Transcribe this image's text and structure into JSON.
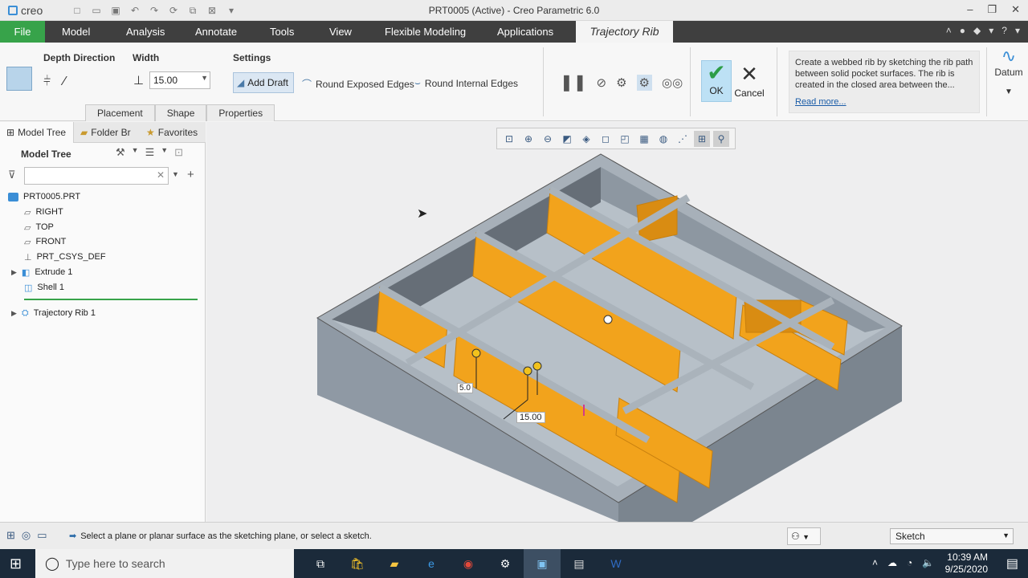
{
  "window": {
    "brand": "creo",
    "title": "PRT0005 (Active) - Creo Parametric 6.0",
    "controls": [
      "minimize-icon",
      "restore-icon",
      "close-icon"
    ]
  },
  "quick_access": [
    "new-icon",
    "open-icon",
    "save-icon",
    "undo-icon",
    "redo-icon",
    "regenerate-icon",
    "windows-icon",
    "close-window-icon",
    "customize-icon"
  ],
  "menu": {
    "file": "File",
    "items": [
      "Model",
      "Analysis",
      "Annotate",
      "Tools",
      "View",
      "Flexible Modeling",
      "Applications"
    ],
    "active_tab": "Trajectory Rib"
  },
  "ribbon": {
    "depth_direction_label": "Depth Direction",
    "width_label": "Width",
    "width_value": "15.00",
    "settings_label": "Settings",
    "add_draft": "Add Draft",
    "round_exposed_edges": "Round Exposed Edges",
    "round_internal_edges": "Round Internal Edges",
    "tabs": [
      "Placement",
      "Shape",
      "Properties"
    ],
    "ok": "OK",
    "cancel": "Cancel",
    "tip_text": "Create a webbed rib by sketching the rib path between solid pocket surfaces. The rib is created in the closed area between the...",
    "read_more": "Read more...",
    "datum": "Datum"
  },
  "panel": {
    "tabs": [
      "Model Tree",
      "Folder Br",
      "Favorites"
    ],
    "tree_header": "Model Tree",
    "search_placeholder": "",
    "items": [
      "PRT0005.PRT",
      "RIGHT",
      "TOP",
      "FRONT",
      "PRT_CSYS_DEF",
      "Extrude 1",
      "Shell 1",
      "Trajectory Rib 1"
    ]
  },
  "viewport": {
    "dim_height": "5.0",
    "dim_width": "15.00",
    "part_color": "#f2a31c",
    "body_color": "#98a2ad"
  },
  "status": {
    "message": "Select a plane or planar surface as the sketching plane, or select a sketch.",
    "filter": "Sketch"
  },
  "taskbar": {
    "search_placeholder": "Type here to search",
    "time": "10:39 AM",
    "date": "9/25/2020"
  }
}
